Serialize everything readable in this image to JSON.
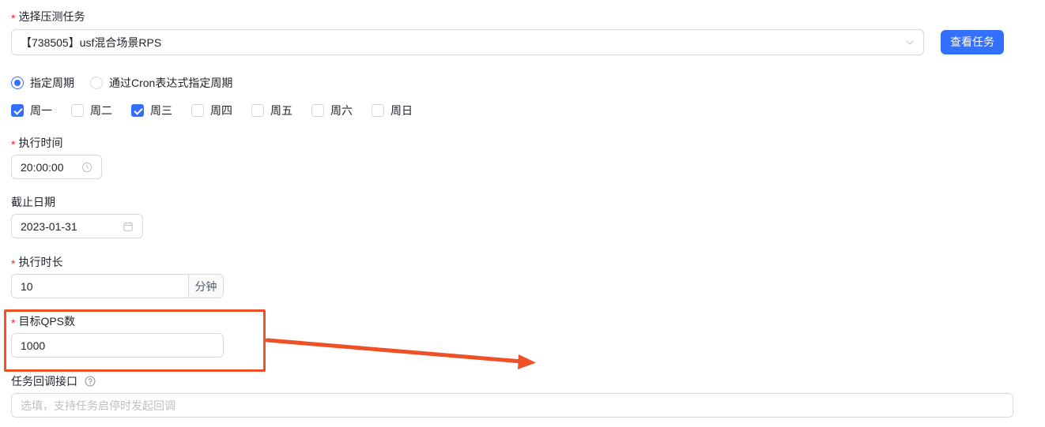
{
  "form": {
    "task_select": {
      "label": "选择压测任务",
      "required": true,
      "value": "【738505】usf混合场景RPS",
      "chevron_icon": "chevron-down-icon"
    },
    "view_task_button": {
      "label": "查看任务",
      "color": "#3370ff"
    },
    "schedule_mode": {
      "options": [
        {
          "label": "指定周期",
          "selected": true
        },
        {
          "label": "通过Cron表达式指定周期",
          "selected": false
        }
      ]
    },
    "weekdays": [
      {
        "label": "周一",
        "checked": true
      },
      {
        "label": "周二",
        "checked": false
      },
      {
        "label": "周三",
        "checked": true
      },
      {
        "label": "周四",
        "checked": false
      },
      {
        "label": "周五",
        "checked": false
      },
      {
        "label": "周六",
        "checked": false
      },
      {
        "label": "周日",
        "checked": false
      }
    ],
    "exec_time": {
      "label": "执行时间",
      "required": true,
      "value": "20:00:00",
      "icon": "clock-icon"
    },
    "end_date": {
      "label": "截止日期",
      "required": false,
      "value": "2023-01-31",
      "icon": "calendar-icon"
    },
    "duration": {
      "label": "执行时长",
      "required": true,
      "value": "10",
      "unit": "分钟"
    },
    "target_qps": {
      "label": "目标QPS数",
      "required": true,
      "value": "1000"
    },
    "callback": {
      "label": "任务回调接口",
      "required": false,
      "help_icon": "question-circle-icon",
      "value": "",
      "placeholder": "选填，支持任务启停时发起回调"
    }
  },
  "annotation": {
    "highlight_color": "#ef5026",
    "target": "target_qps"
  }
}
